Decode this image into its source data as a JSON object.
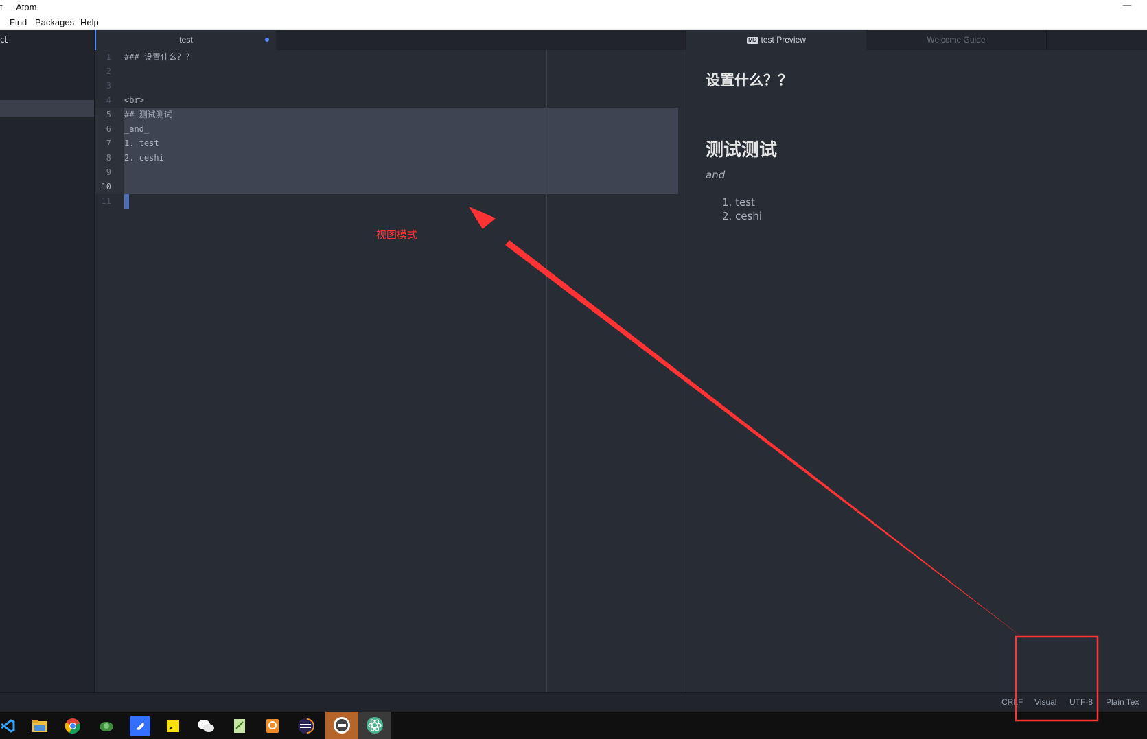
{
  "window": {
    "title": "t — Atom",
    "minimize_glyph": "—"
  },
  "menubar": {
    "items": [
      "Find",
      "Packages",
      "Help"
    ]
  },
  "tree": {
    "header": "ct"
  },
  "editor": {
    "tab_label": "test",
    "lines": [
      {
        "num": "1",
        "text": "### 设置什么？？"
      },
      {
        "num": "2",
        "text": ""
      },
      {
        "num": "3",
        "text": ""
      },
      {
        "num": "4",
        "text": "<br>"
      },
      {
        "num": "5",
        "text": "## 测试测试"
      },
      {
        "num": "6",
        "text": "_and_"
      },
      {
        "num": "7",
        "text": "1. test"
      },
      {
        "num": "8",
        "text": "2. ceshi"
      },
      {
        "num": "9",
        "text": ""
      },
      {
        "num": "10",
        "text": ""
      },
      {
        "num": "11",
        "text": ""
      }
    ]
  },
  "preview": {
    "tabs": {
      "preview_icon": "MD",
      "preview_label": "test Preview",
      "welcome_label": "Welcome Guide"
    },
    "h3": "设置什么？？",
    "h2": "测试测试",
    "em": "and",
    "list": [
      "1. test",
      "2. ceshi"
    ]
  },
  "annotation": {
    "label": "视图模式",
    "color": "#ff3333"
  },
  "statusbar": {
    "line_ending": "CRLF",
    "mode": "Visual",
    "encoding": "UTF-8",
    "grammar": "Plain Tex"
  },
  "taskbar": {
    "icons": [
      "vscode-icon",
      "file-explorer-icon",
      "chrome-icon",
      "turtle-icon",
      "feishu-icon",
      "sticky-notes-icon",
      "wechat-icon",
      "notepad-icon",
      "pdf-app-icon",
      "eclipse-icon",
      "navicat-icon",
      "atom-icon"
    ]
  },
  "colors": {
    "accent": "#528bff",
    "editor_bg": "#282c34",
    "annotation": "#ff3333"
  }
}
